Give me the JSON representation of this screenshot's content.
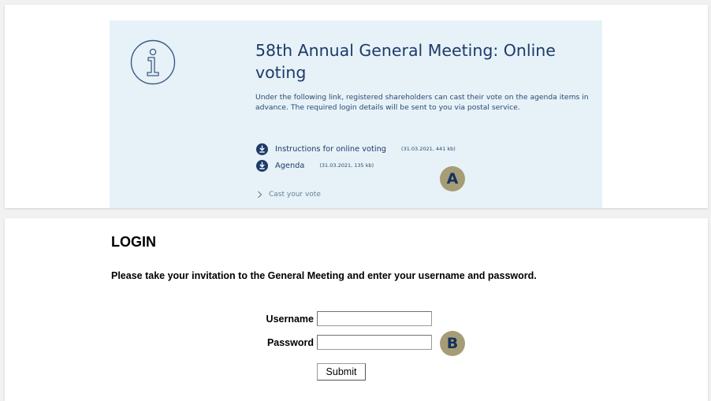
{
  "meeting": {
    "title": "58th Annual General Meeting: Online voting",
    "description": "Under the following link, registered shareholders can cast their vote on the agenda items in advance. The required login details will be sent to you via postal service.",
    "documents": [
      {
        "label": "Instructions for online voting",
        "meta": "(31.03.2021, 441 kb)",
        "icon": "download-icon"
      },
      {
        "label": "Agenda",
        "meta": "(31.03.2021, 135 kb)",
        "icon": "download-icon"
      }
    ],
    "cast_vote_link": "Cast your vote",
    "info_icon": "info-icon"
  },
  "markers": {
    "a": "A",
    "b": "B"
  },
  "login": {
    "heading": "LOGIN",
    "instructions": "Please take your invitation to the General Meeting and enter your username and password.",
    "username_label": "Username",
    "username_value": "",
    "password_label": "Password",
    "password_value": "",
    "submit_label": "Submit"
  },
  "colors": {
    "info_box_background": "#e6f2f7",
    "brand_navy": "#1e3a6a",
    "marker_background": "#a69d76"
  }
}
